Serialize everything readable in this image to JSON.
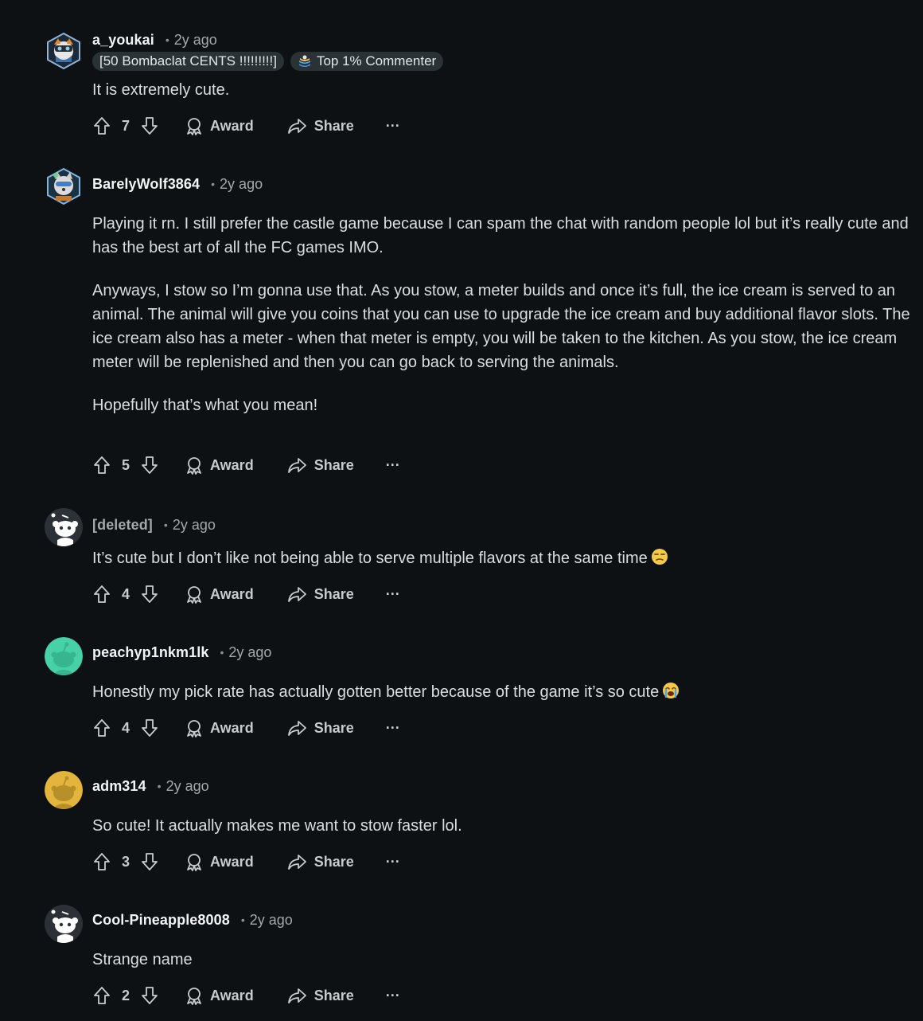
{
  "comments": [
    {
      "author": "a_youkai",
      "time": "2y ago",
      "flairs": [
        "[50 Bombaclat CENTS !!!!!!!!!]",
        "Top 1% Commenter"
      ],
      "paragraphs": [
        "It is extremely cute."
      ],
      "score": "7",
      "avatar": "snoo-custom-tiger"
    },
    {
      "author": "BarelyWolf3864",
      "time": "2y ago",
      "paragraphs": [
        "Playing it rn. I still prefer the castle game because I can spam the chat with random people lol but it’s really cute and has the best art of all the FC games IMO.",
        "Anyways, I stow so I’m gonna use that. As you stow, a meter builds and once it’s full, the ice cream is served to an animal. The animal will give you coins that you can use to upgrade the ice cream and buy additional flavor slots. The ice cream also has a meter - when that meter is empty, you will be taken to the kitchen. As you stow, the ice cream meter will be replenished and then you can go back to serving the animals.",
        "Hopefully that’s what you mean!"
      ],
      "score": "5",
      "avatar": "snoo-custom-wolf"
    },
    {
      "author": "[deleted]",
      "time": "2y ago",
      "paragraphs": [
        "It’s cute but I don’t like not being able to serve multiple flavors at the same time"
      ],
      "emoji": "unamused-face",
      "score": "4",
      "avatar": "snoo-default-white"
    },
    {
      "author": "peachyp1nkm1lk",
      "time": "2y ago",
      "paragraphs": [
        "Honestly my pick rate has actually gotten better because of the game it’s so cute"
      ],
      "emoji": "crying-face",
      "score": "4",
      "avatar": "snoo-teal"
    },
    {
      "author": "adm314",
      "time": "2y ago",
      "paragraphs": [
        "So cute! It actually makes me want to stow faster lol."
      ],
      "score": "3",
      "avatar": "snoo-yellow"
    },
    {
      "author": "Cool-Pineapple8008",
      "time": "2y ago",
      "paragraphs": [
        "Strange name"
      ],
      "score": "2",
      "avatar": "snoo-default-white"
    }
  ],
  "actions": {
    "award_label": "Award",
    "share_label": "Share",
    "more_label": "···"
  },
  "colors": {
    "background": "#0e1113",
    "teal_avatar": "#46d1a6",
    "yellow_avatar": "#e3b53c"
  }
}
